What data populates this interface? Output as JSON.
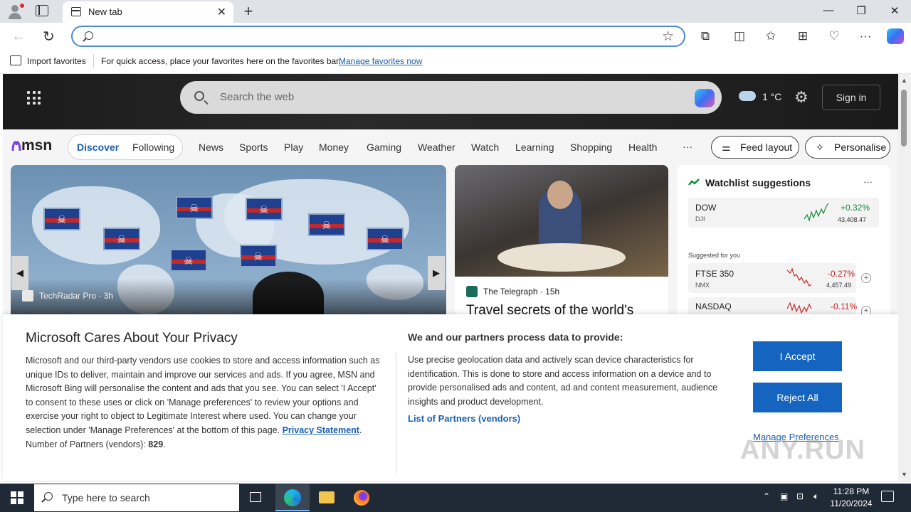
{
  "browser": {
    "tab_title": "New tab",
    "address_value": "",
    "favorites_bar": {
      "import_label": "Import favorites",
      "message": "For quick access, place your favorites here on the favorites bar.",
      "manage_link": "Manage favorites now"
    }
  },
  "msn": {
    "search_placeholder": "Search the web",
    "weather_temp": "1 °C",
    "signin_label": "Sign in",
    "logo_text": "msn",
    "tabs": [
      "Discover",
      "Following"
    ],
    "nav_items": [
      "News",
      "Sports",
      "Play",
      "Money",
      "Gaming",
      "Weather",
      "Watch",
      "Learning",
      "Shopping",
      "Health"
    ],
    "more_label": "···",
    "feed_layout_label": "Feed layout",
    "personalise_label": "Personalise",
    "card1": {
      "source": "TechRadar Pro · 3h"
    },
    "card2": {
      "source": "The Telegraph · 15h",
      "title": "Travel secrets of the world's"
    },
    "watchlist": {
      "title": "Watchlist suggestions",
      "menu": "···",
      "suggested_label": "Suggested for you",
      "items": [
        {
          "ticker": "DOW",
          "sub": "DJI",
          "change": "+0.32%",
          "value": "43,408.47",
          "trend": "up"
        },
        {
          "ticker": "FTSE 350",
          "sub": "NMX",
          "change": "-0.27%",
          "value": "4,457.49",
          "trend": "down"
        },
        {
          "ticker": "NASDAQ",
          "sub": "",
          "change": "-0.11%",
          "value": "",
          "trend": "down"
        }
      ]
    }
  },
  "privacy": {
    "title": "Microsoft Cares About Your Privacy",
    "body": "Microsoft and our third-party vendors use cookies to store and access information such as unique IDs to deliver, maintain and improve our services and ads. If you agree, MSN and Microsoft Bing will personalise the content and ads that you see. You can select 'I Accept' to consent to these uses or click on 'Manage preferences' to review your options and exercise your right to object to Legitimate Interest where used.  You can change your selection under 'Manage Preferences' at the bottom of this page.",
    "privacy_link": "Privacy Statement",
    "partners_label": "Number of Partners (vendors):",
    "partners_count": "829",
    "heading2": "We and our partners process data to provide:",
    "body2": "Use precise geolocation data and actively scan device characteristics for identification. This is done to store and access information on a device and to provide personalised ads and content, ad and content measurement, audience insights and product development.",
    "list_link": "List of Partners (vendors)",
    "accept_label": "I Accept",
    "reject_label": "Reject All",
    "manage_label": "Manage Preferences"
  },
  "watermark": "ANY.RUN",
  "taskbar": {
    "search_placeholder": "Type here to search",
    "time": "11:28 PM",
    "date": "11/20/2024"
  },
  "colors": {
    "accent": "#1565c0",
    "link": "#1b5fb3",
    "positive": "#1a8a3a",
    "negative": "#c62828",
    "taskbar": "#1f2a36"
  },
  "icons": [
    "profile-icon",
    "tab-actions-icon",
    "new-tab-icon",
    "minimize-icon",
    "restore-icon",
    "close-icon",
    "back-icon",
    "refresh-icon",
    "search-icon",
    "favorite-star-icon",
    "extensions-icon",
    "split-screen-icon",
    "favorites-icon",
    "collections-icon",
    "performance-icon",
    "more-icon",
    "copilot-icon",
    "apps-grid-icon",
    "weather-cloud-icon",
    "settings-gear-icon",
    "windows-start-icon",
    "task-view-icon",
    "edge-icon",
    "file-explorer-icon",
    "firefox-icon"
  ]
}
